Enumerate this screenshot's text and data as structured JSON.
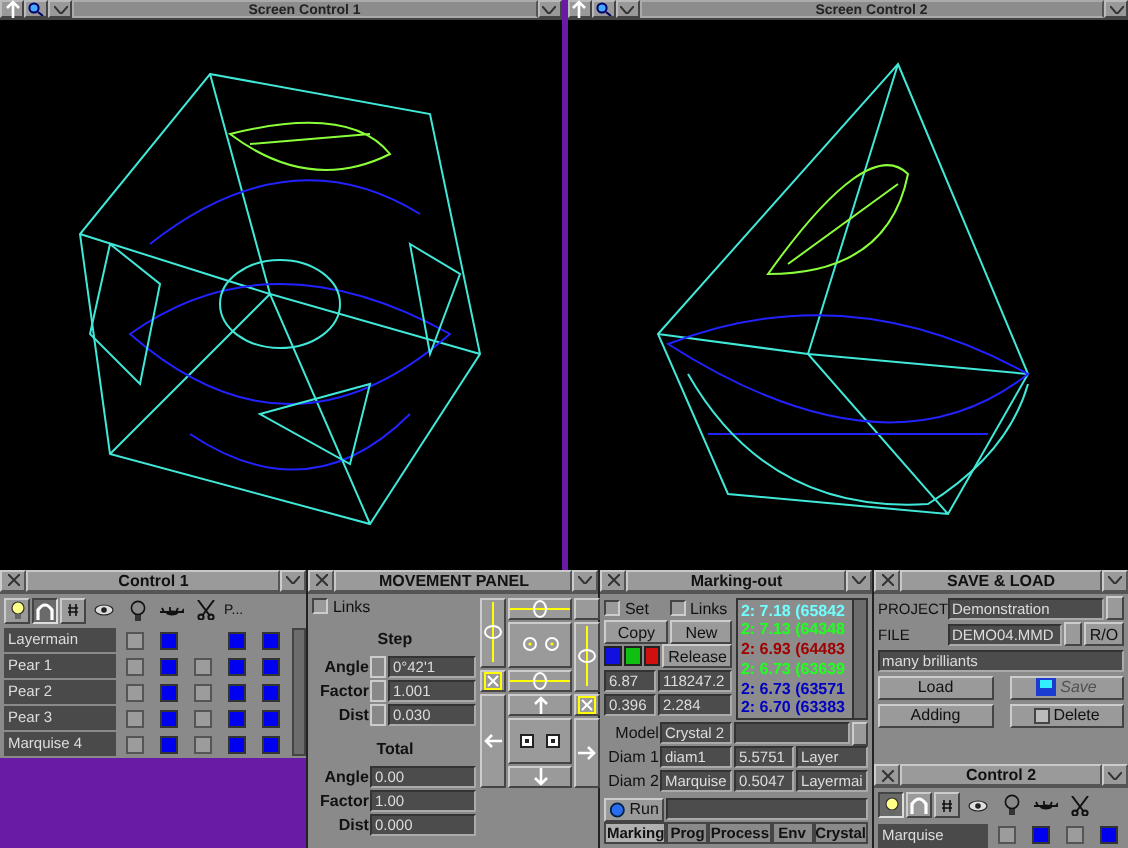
{
  "viewports": [
    {
      "title": "Screen Control 1",
      "kind": "cube"
    },
    {
      "title": "Screen Control 2",
      "kind": "diamond"
    }
  ],
  "control1": {
    "title": "Control 1",
    "tools": [
      {
        "kind": "bulb",
        "selected": false
      },
      {
        "kind": "curve",
        "selected": true
      },
      {
        "kind": "hash",
        "selected": false
      }
    ],
    "column_label": "P...",
    "rows": [
      {
        "name": "Layermain",
        "cells": [
          {
            "kind": "toggle",
            "on": false
          },
          {
            "kind": "toggle",
            "on": true
          },
          {
            "kind": "blank"
          },
          {
            "kind": "toggle",
            "on": true
          },
          {
            "kind": "toggle",
            "on": true
          }
        ]
      },
      {
        "name": "Pear 1",
        "cells": [
          {
            "kind": "toggle",
            "on": false
          },
          {
            "kind": "toggle",
            "on": true
          },
          {
            "kind": "toggle",
            "on": false
          },
          {
            "kind": "toggle",
            "on": true
          },
          {
            "kind": "toggle",
            "on": true
          }
        ]
      },
      {
        "name": "Pear 2",
        "cells": [
          {
            "kind": "toggle",
            "on": false
          },
          {
            "kind": "toggle",
            "on": true
          },
          {
            "kind": "toggle",
            "on": false
          },
          {
            "kind": "toggle",
            "on": true
          },
          {
            "kind": "toggle",
            "on": true
          }
        ]
      },
      {
        "name": "Pear 3",
        "cells": [
          {
            "kind": "toggle",
            "on": false
          },
          {
            "kind": "toggle",
            "on": true
          },
          {
            "kind": "toggle",
            "on": false
          },
          {
            "kind": "toggle",
            "on": true
          },
          {
            "kind": "toggle",
            "on": true
          }
        ]
      },
      {
        "name": "Marquise 4",
        "cells": [
          {
            "kind": "toggle",
            "on": false
          },
          {
            "kind": "toggle",
            "on": true
          },
          {
            "kind": "toggle",
            "on": false
          },
          {
            "kind": "toggle",
            "on": true
          },
          {
            "kind": "toggle",
            "on": true
          }
        ]
      }
    ]
  },
  "movement": {
    "title": "MOVEMENT PANEL",
    "links": {
      "label": "Links",
      "checked": false
    },
    "step_label": "Step",
    "total_label": "Total",
    "step": [
      {
        "label": "Angle",
        "value": "0°42'1"
      },
      {
        "label": "Factor",
        "value": "1.001"
      },
      {
        "label": "Dist",
        "value": "0.030"
      }
    ],
    "total": [
      {
        "label": "Angle",
        "value": "0.00"
      },
      {
        "label": "Factor",
        "value": "1.00"
      },
      {
        "label": "Dist",
        "value": "0.000"
      }
    ]
  },
  "marking": {
    "title": "Marking-out",
    "checks": [
      {
        "label": "Set",
        "checked": false
      },
      {
        "label": "Links",
        "checked": false
      }
    ],
    "buttons": [
      "Copy",
      "New",
      "Release"
    ],
    "swatches": [
      {
        "color": "#1010e0"
      },
      {
        "color": "#10c010"
      },
      {
        "color": "#d01010"
      }
    ],
    "values": [
      "6.87",
      "118247.2",
      "0.396",
      "2.284"
    ],
    "list": [
      {
        "text": "2: 7.18 (65842",
        "color": "#70ffff"
      },
      {
        "text": "2: 7.13 (64348",
        "color": "#20ff20"
      },
      {
        "text": "2: 6.93 (64483",
        "color": "#a00000"
      },
      {
        "text": "2: 6.73 (63639",
        "color": "#20ff20"
      },
      {
        "text": "2: 6.73 (63571",
        "color": "#0000c0"
      },
      {
        "text": "2: 6.70 (63383",
        "color": "#0000c0"
      }
    ],
    "model": {
      "label": "Model",
      "value": "Crystal 2"
    },
    "diam1": {
      "label": "Diam 1",
      "value": "diam1",
      "number": "5.5751",
      "layer": "Layer"
    },
    "diam2": {
      "label": "Diam 2",
      "value": "Marquise",
      "number": "0.5047",
      "layer": "Layermai"
    },
    "run": "Run",
    "tabs": [
      {
        "label": "Marking",
        "selected": true
      },
      {
        "label": "Prog",
        "selected": false
      },
      {
        "label": "Process",
        "selected": false
      },
      {
        "label": "Env",
        "selected": false
      },
      {
        "label": "Crystal",
        "selected": false
      }
    ]
  },
  "save_load": {
    "title": "SAVE & LOAD",
    "project_label": "PROJECT",
    "project": "Demonstration",
    "file_label": "FILE",
    "file": "DEMO04.MMD",
    "readonly": "R/O",
    "description": "many brilliants",
    "buttons": [
      {
        "label": "Load",
        "kind": "plain",
        "disabled": false
      },
      {
        "label": "Save",
        "kind": "disk",
        "disabled": true
      },
      {
        "label": "Adding",
        "kind": "plain",
        "disabled": false
      },
      {
        "label": "Delete",
        "kind": "box",
        "disabled": false
      }
    ]
  },
  "control2": {
    "title": "Control 2",
    "tools": [
      {
        "kind": "bulb",
        "selected": true
      },
      {
        "kind": "curve",
        "selected": false
      },
      {
        "kind": "hash",
        "selected": false
      }
    ],
    "rows": [
      {
        "name": "Marquise",
        "cells": [
          {
            "kind": "toggle",
            "on": false
          },
          {
            "kind": "toggle",
            "on": true
          },
          {
            "kind": "toggle",
            "on": false
          },
          {
            "kind": "toggle",
            "on": true
          }
        ]
      }
    ]
  }
}
